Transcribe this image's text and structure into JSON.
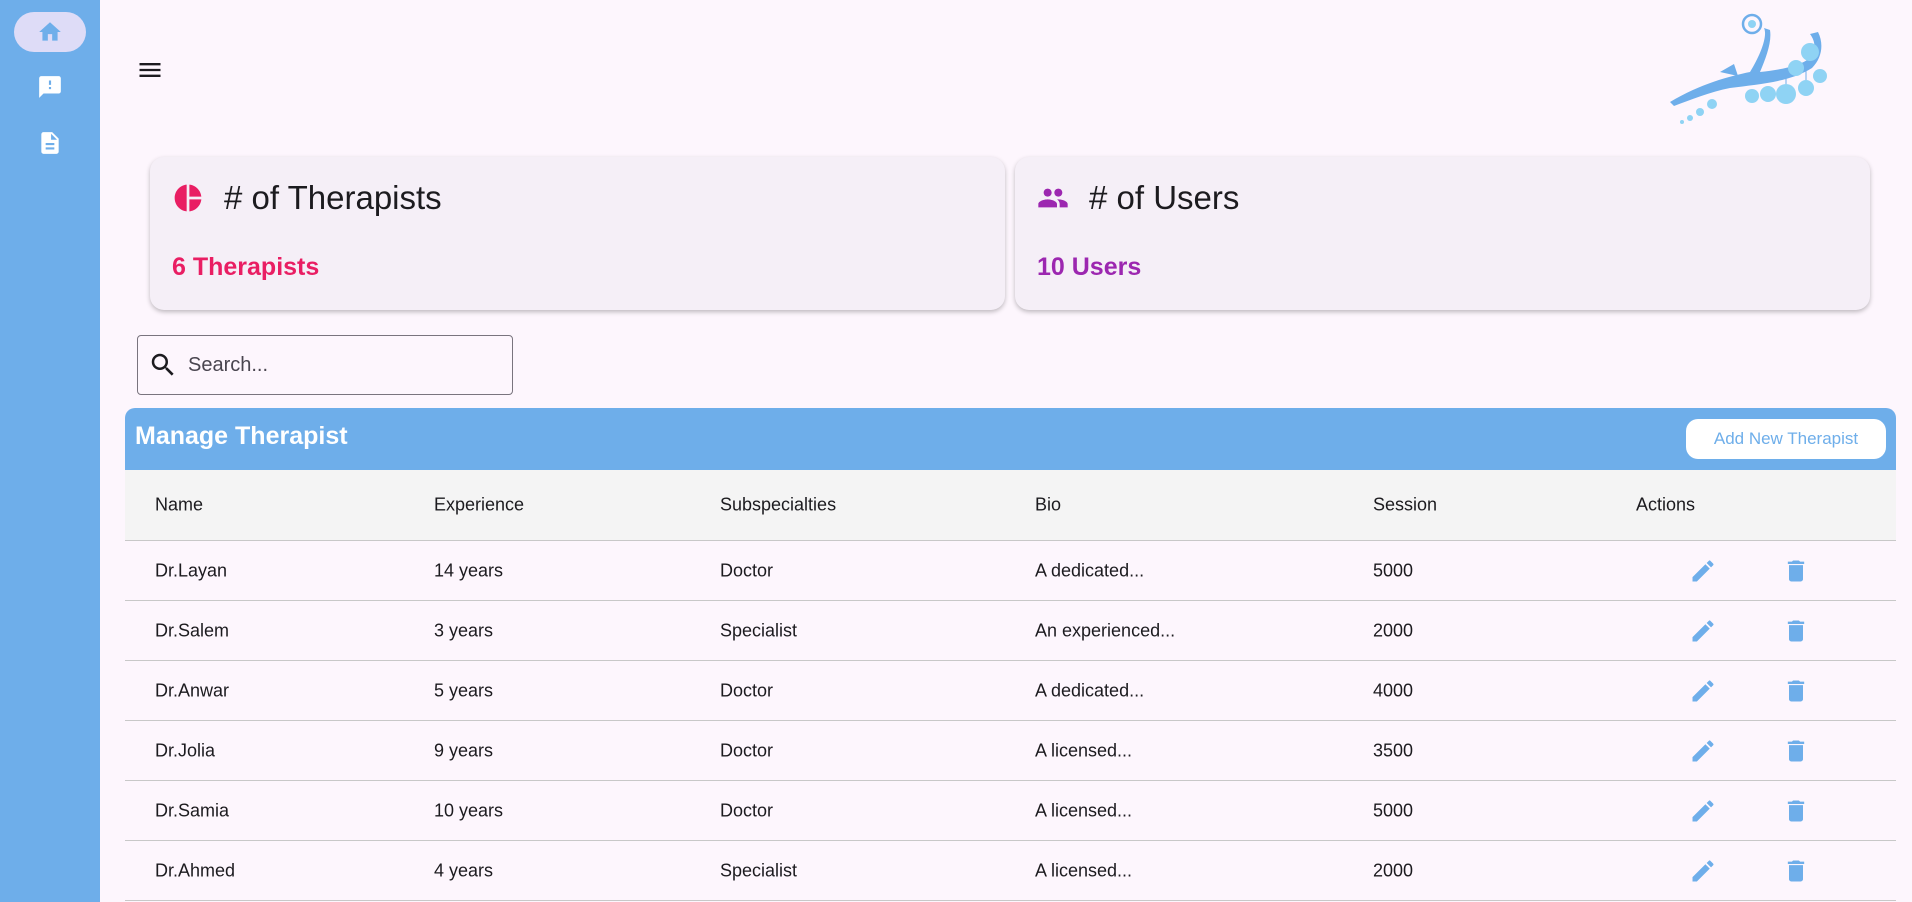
{
  "colors": {
    "primary": "#6eaeea",
    "therapists_accent": "#e91e63",
    "users_accent": "#9c27b0",
    "active_nav": "#dedcf7"
  },
  "sidebar": {
    "items": [
      {
        "icon": "home-icon",
        "active": true
      },
      {
        "icon": "feedback-icon",
        "active": false
      },
      {
        "icon": "document-icon",
        "active": false
      }
    ]
  },
  "stats": {
    "therapists": {
      "icon": "pie-chart-icon",
      "title": "# of Therapists",
      "value": "6 Therapists"
    },
    "users": {
      "icon": "users-icon",
      "title": "# of Users",
      "value": "10 Users"
    }
  },
  "search": {
    "placeholder": "Search..."
  },
  "panel": {
    "title": "Manage Therapist",
    "add_button": "Add New Therapist"
  },
  "table": {
    "headers": {
      "name": "Name",
      "experience": "Experience",
      "subspecialties": "Subspecialties",
      "bio": "Bio",
      "session": "Session",
      "actions": "Actions"
    },
    "rows": [
      {
        "name": "Dr.Layan",
        "experience": "14 years",
        "subspecialties": "Doctor",
        "bio": "A dedicated...",
        "session": "5000"
      },
      {
        "name": "Dr.Salem",
        "experience": "3 years",
        "subspecialties": "Specialist",
        "bio": "An experienced...",
        "session": "2000"
      },
      {
        "name": "Dr.Anwar",
        "experience": "5 years",
        "subspecialties": "Doctor",
        "bio": "A dedicated...",
        "session": "4000"
      },
      {
        "name": "Dr.Jolia",
        "experience": "9 years",
        "subspecialties": "Doctor",
        "bio": "A licensed...",
        "session": "3500"
      },
      {
        "name": "Dr.Samia",
        "experience": "10 years",
        "subspecialties": "Doctor",
        "bio": "A licensed...",
        "session": "5000"
      },
      {
        "name": "Dr.Ahmed",
        "experience": "4 years",
        "subspecialties": "Specialist",
        "bio": "A licensed...",
        "session": "2000"
      }
    ]
  }
}
